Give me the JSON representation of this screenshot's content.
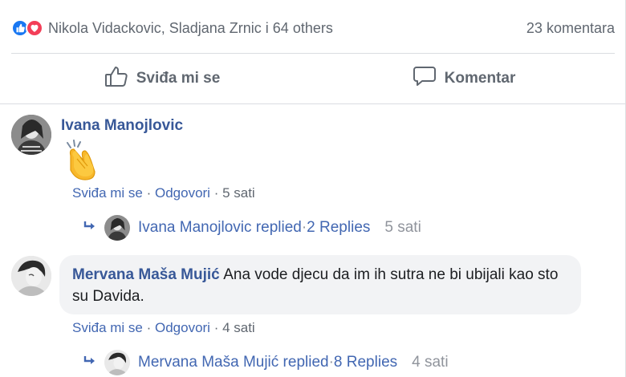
{
  "post": {
    "reaction_names": "Nikola Vidackovic, Sladjana Zrnic i 64 others",
    "comment_count": "23 komentara",
    "reaction_icons": [
      "like-icon",
      "love-icon"
    ],
    "colors": {
      "like": "#1877f2",
      "love": "#f33e58",
      "link": "#385898"
    }
  },
  "actions": {
    "like_label": "Sviđa mi se",
    "comment_label": "Komentar"
  },
  "comments": [
    {
      "author": "Ivana Manojlovic",
      "text": "",
      "emoji": "👏",
      "meta": {
        "like": "Sviđa mi se",
        "sep1": " · ",
        "reply": "Odgovori",
        "sep2": " · ",
        "time": "5 sati"
      },
      "replies": {
        "author": "Ivana Manojlovic replied",
        "sep": " · ",
        "count": "2 Replies",
        "time": "5 sati"
      }
    },
    {
      "author": "Mervana Maša Mujić",
      "text": "Ana vode djecu da im ih sutra ne bi ubijali kao sto su Davida.",
      "meta": {
        "like": "Sviđa mi se",
        "sep1": " · ",
        "reply": "Odgovori",
        "sep2": " · ",
        "time": "4 sati"
      },
      "replies": {
        "author": "Mervana Maša Mujić replied",
        "sep": " · ",
        "count": "8 Replies",
        "time": "4 sati"
      }
    }
  ]
}
